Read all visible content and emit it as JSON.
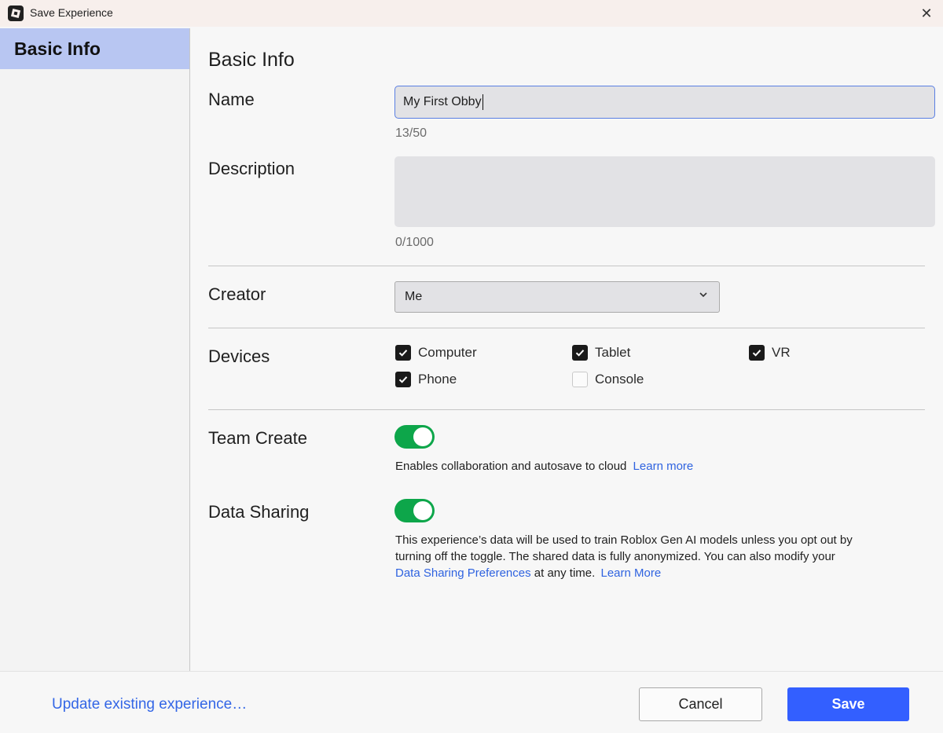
{
  "window": {
    "title": "Save Experience",
    "close_icon": "close-icon",
    "app_icon": "roblox-studio-icon"
  },
  "sidebar": {
    "items": [
      {
        "label": "Basic Info",
        "selected": true
      }
    ]
  },
  "main": {
    "heading": "Basic Info",
    "name": {
      "label": "Name",
      "value": "My First Obby",
      "counter": "13/50"
    },
    "description": {
      "label": "Description",
      "value": "",
      "counter": "0/1000"
    },
    "creator": {
      "label": "Creator",
      "value": "Me"
    },
    "devices": {
      "label": "Devices",
      "options": [
        {
          "label": "Computer",
          "checked": true
        },
        {
          "label": "Tablet",
          "checked": true
        },
        {
          "label": "VR",
          "checked": true
        },
        {
          "label": "Phone",
          "checked": true
        },
        {
          "label": "Console",
          "checked": false
        }
      ]
    },
    "team_create": {
      "label": "Team Create",
      "enabled": true,
      "help_text": "Enables collaboration and autosave to cloud",
      "learn_more": "Learn more"
    },
    "data_sharing": {
      "label": "Data Sharing",
      "enabled": true,
      "help_line1": "This experience’s data will be used to train Roblox Gen AI models unless you opt out by",
      "help_line2": "turning off the toggle. The shared data is fully anonymized. You can also modify your",
      "prefs_link": "Data Sharing Preferences",
      "help_line3": "at any time.",
      "learn_more": "Learn More"
    }
  },
  "footer": {
    "update_link": "Update existing experience…",
    "cancel_label": "Cancel",
    "save_label": "Save"
  },
  "colors": {
    "accent": "#335fff",
    "toggle_on": "#0da64a",
    "link": "#2f63e0",
    "sidebar_selected": "#b8c6f2"
  }
}
